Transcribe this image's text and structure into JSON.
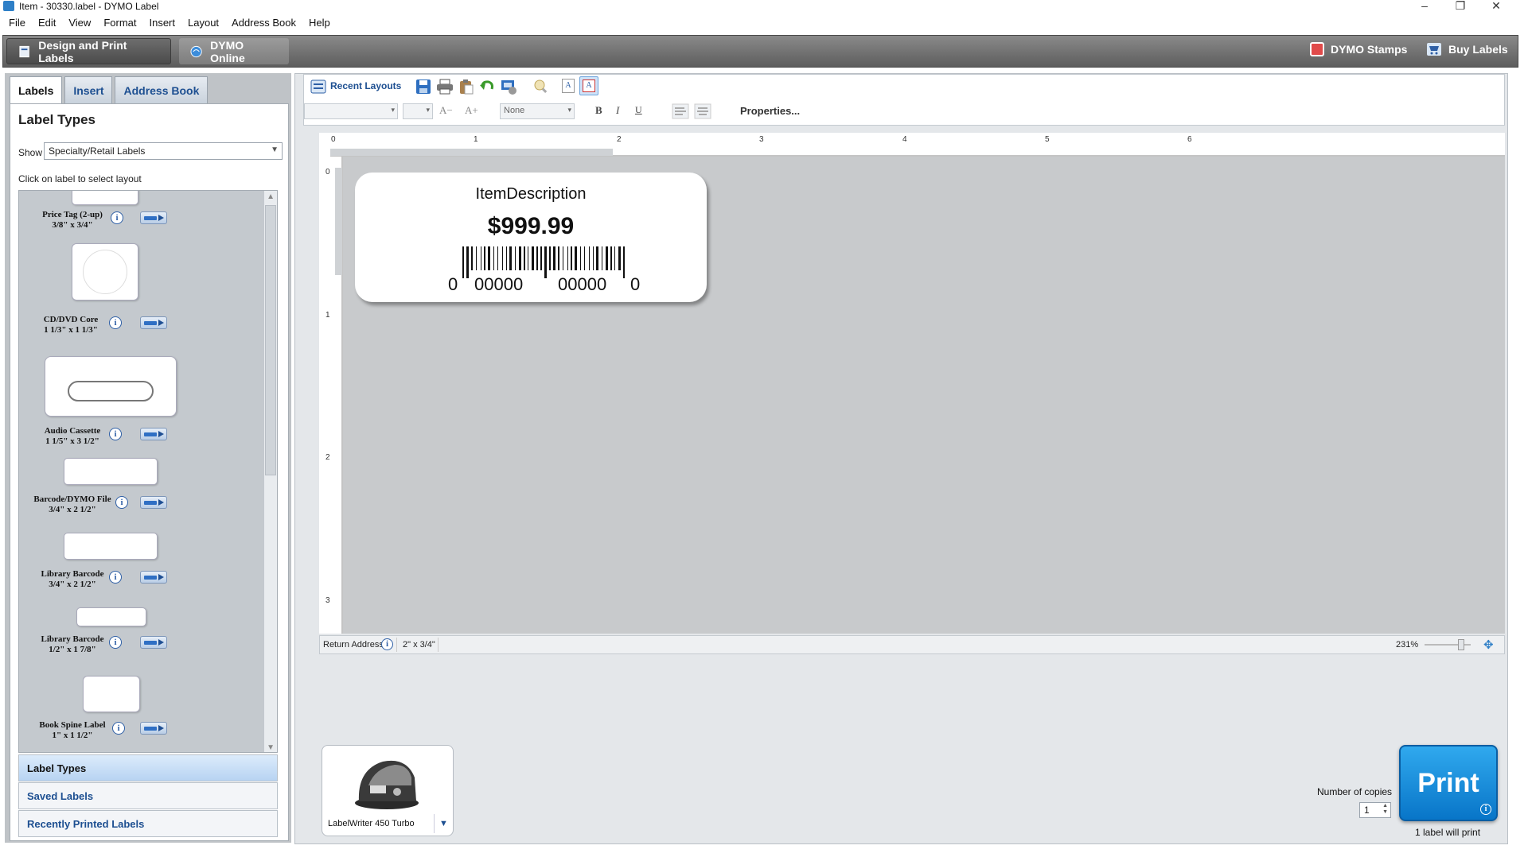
{
  "window": {
    "title": "Item - 30330.label - DYMO Label",
    "minimize": "–",
    "restore": "❐",
    "close": "✕"
  },
  "menu": [
    "File",
    "Edit",
    "View",
    "Format",
    "Insert",
    "Layout",
    "Address Book",
    "Help"
  ],
  "header": {
    "design_tab": "Design and Print Labels",
    "online_tab": "DYMO Online",
    "stamps": "DYMO Stamps",
    "buy": "Buy Labels"
  },
  "left": {
    "tabs": [
      "Labels",
      "Insert",
      "Address Book"
    ],
    "heading": "Label Types",
    "show_label": "Show",
    "show_value": "Specialty/Retail Labels",
    "hint": "Click on label to select layout",
    "items": [
      {
        "name": "Price Tag (2-up)",
        "size": "3/8\" x 3/4\""
      },
      {
        "name": "CD/DVD Core",
        "size": "1 1/3\" x 1 1/3\""
      },
      {
        "name": "Audio Cassette",
        "size": "1 1/5\" x 3 1/2\""
      },
      {
        "name": "Barcode/DYMO File",
        "size": "3/4\" x 2 1/2\""
      },
      {
        "name": "Library Barcode",
        "size": "3/4\" x 2 1/2\""
      },
      {
        "name": "Library Barcode",
        "size": "1/2\" x 1 7/8\""
      },
      {
        "name": "Book Spine Label",
        "size": "1\" x 1 1/2\""
      }
    ],
    "accordion": [
      "Label Types",
      "Saved Labels",
      "Recently Printed Labels"
    ]
  },
  "toolbar": {
    "recent_layouts": "Recent Layouts",
    "rotation_value": "None",
    "bold": "B",
    "italic": "I",
    "underline": "U",
    "properties": "Properties..."
  },
  "rulers": {
    "h": [
      "0",
      "1",
      "2",
      "3",
      "4",
      "5",
      "6"
    ],
    "v": [
      "0",
      "1",
      "2",
      "3"
    ]
  },
  "label": {
    "description": "ItemDescription",
    "price": "$999.99",
    "barcode_left": "0",
    "barcode_group1": "00000",
    "barcode_group2": "00000",
    "barcode_right": "0"
  },
  "status": {
    "return_address": "Return Address",
    "size": "2\" x 3/4\"",
    "zoom": "231%"
  },
  "printer": {
    "name": "LabelWriter 450 Turbo"
  },
  "print": {
    "copies_label": "Number of copies",
    "copies": "1",
    "button": "Print",
    "will_print": "1 label will print"
  }
}
